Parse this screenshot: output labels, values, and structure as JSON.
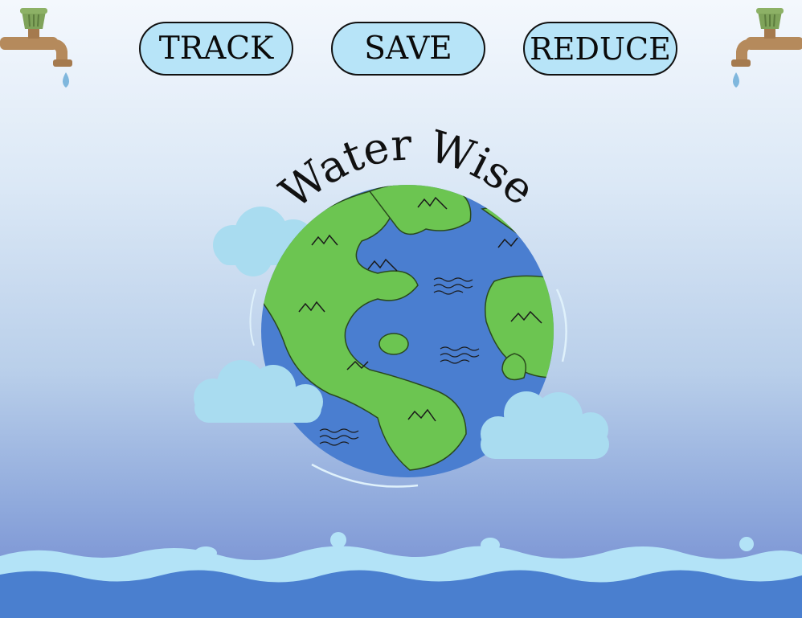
{
  "nav": {
    "track_label": "TRACK",
    "save_label": "SAVE",
    "reduce_label": "REDUCE"
  },
  "logo": {
    "title": "Water Wise"
  },
  "colors": {
    "button_fill": "#b7e4f8",
    "land": "#6cc551",
    "ocean": "#4a7ed0",
    "cloud": "#a9dcf0",
    "water_light": "#b3e3f7",
    "water_dark": "#4a7fcf",
    "faucet": "#b58a5c",
    "faucet_handle": "#7fa35a"
  },
  "icons": {
    "left_faucet": "faucet-icon",
    "right_faucet": "faucet-icon",
    "globe": "globe-icon"
  }
}
